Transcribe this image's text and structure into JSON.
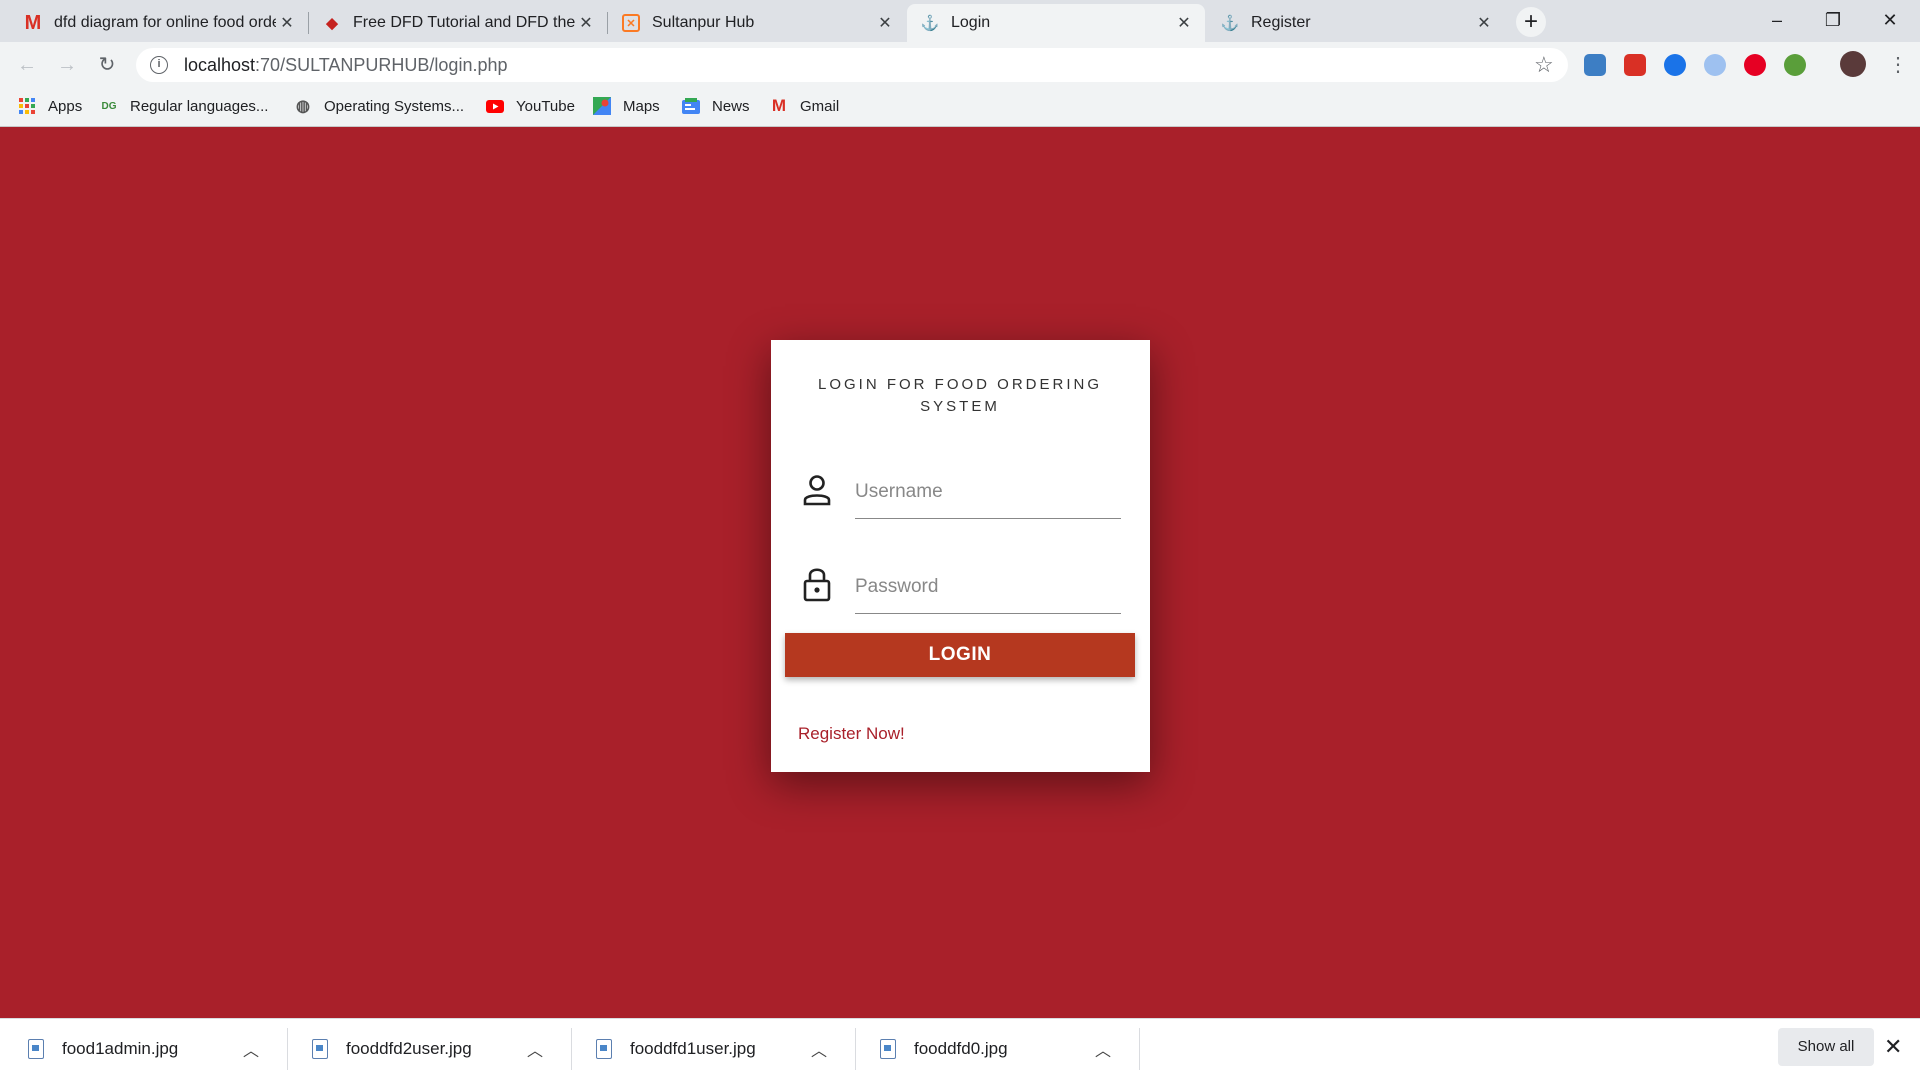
{
  "browser": {
    "tabs": [
      {
        "title": "dfd diagram for online food orde",
        "icon": "gmail-m-icon"
      },
      {
        "title": "Free DFD Tutorial and DFD the b",
        "icon": "diamond-icon"
      },
      {
        "title": "Sultanpur Hub",
        "icon": "xampp-icon"
      },
      {
        "title": "Login",
        "icon": "site-icon",
        "active": true
      },
      {
        "title": "Register",
        "icon": "site-icon"
      }
    ],
    "new_tab": "+",
    "window_controls": {
      "minimize": "–",
      "maximize": "❐",
      "close": "✕"
    },
    "url_host": "localhost",
    "url_path": ":70/SULTANPURHUB/login.php",
    "bookmarks": [
      {
        "label": "Apps",
        "icon": "apps-grid-icon"
      },
      {
        "label": "Regular languages...",
        "icon": "dg-icon"
      },
      {
        "label": "Operating Systems...",
        "icon": "globe-icon"
      },
      {
        "label": "YouTube",
        "icon": "youtube-icon"
      },
      {
        "label": "Maps",
        "icon": "maps-icon"
      },
      {
        "label": "News",
        "icon": "news-icon"
      },
      {
        "label": "Gmail",
        "icon": "gmail-icon"
      }
    ]
  },
  "login": {
    "title": "LOGIN FOR FOOD ORDERING SYSTEM",
    "username_placeholder": "Username",
    "password_placeholder": "Password",
    "button_label": "LOGIN",
    "register_link": "Register Now!"
  },
  "downloads": {
    "items": [
      {
        "name": "food1admin.jpg"
      },
      {
        "name": "fooddfd2user.jpg"
      },
      {
        "name": "fooddfd1user.jpg"
      },
      {
        "name": "fooddfd0.jpg"
      }
    ],
    "show_all": "Show all"
  },
  "colors": {
    "page_background": "#a9202a",
    "button": "#b5381f",
    "link": "#a9202a"
  }
}
